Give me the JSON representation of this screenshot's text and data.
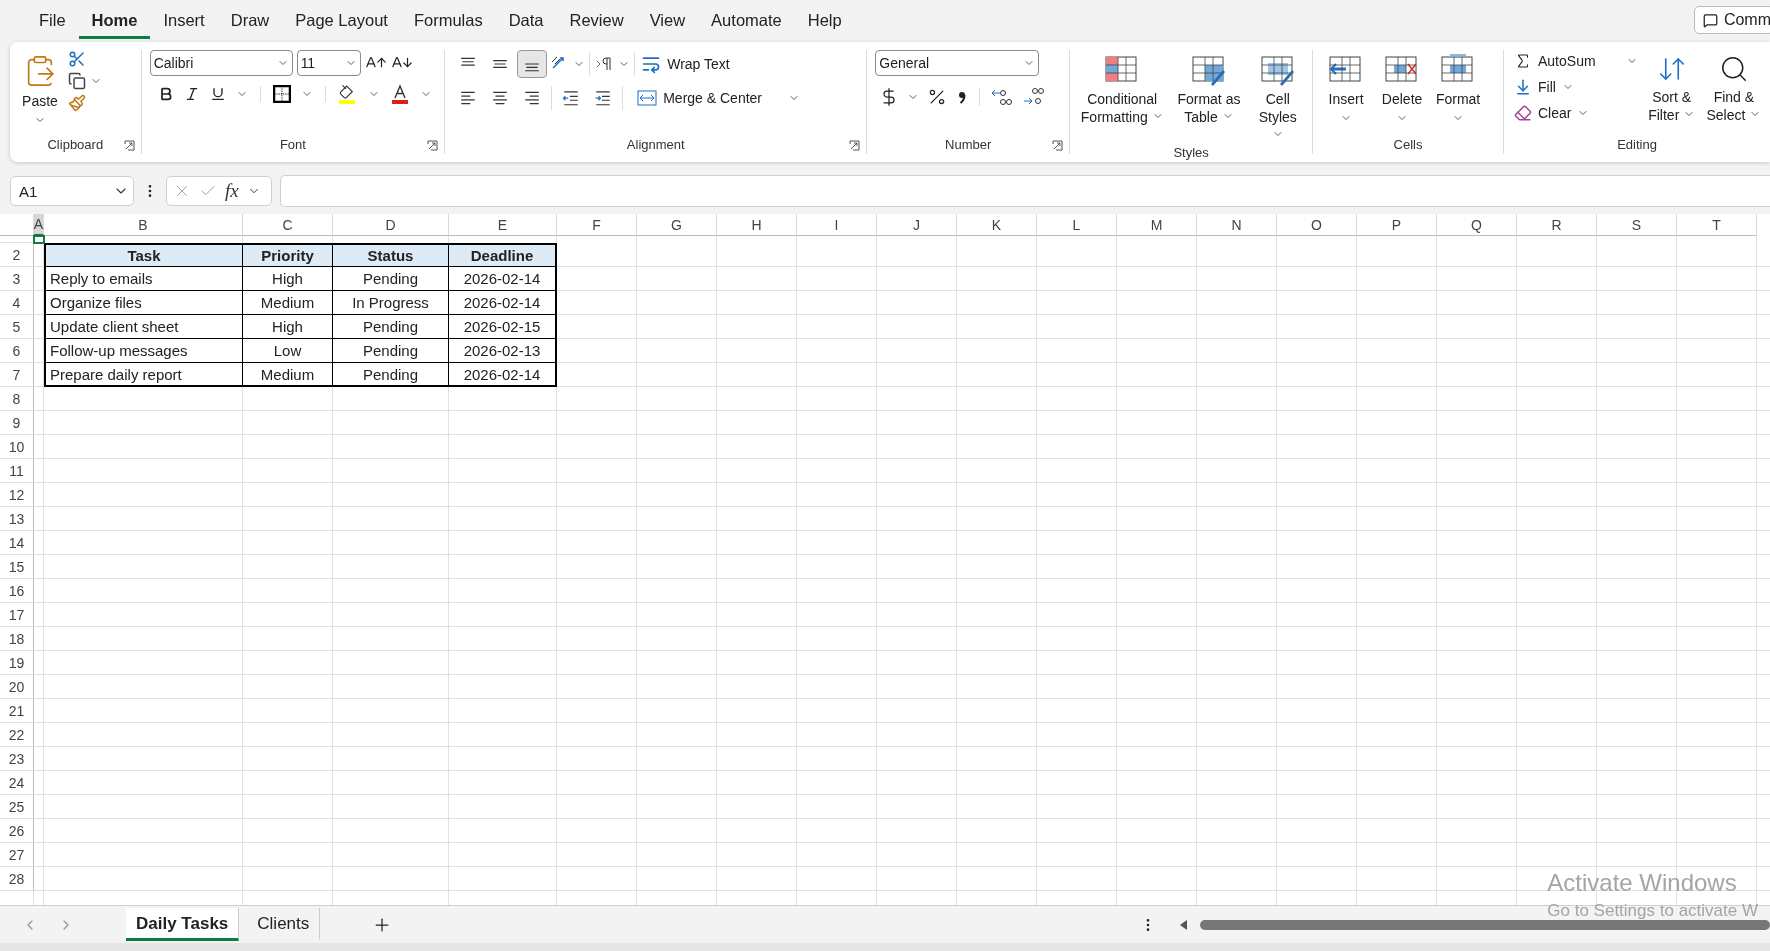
{
  "menu_tabs": [
    {
      "label": "File",
      "selected": false
    },
    {
      "label": "Home",
      "selected": true
    },
    {
      "label": "Insert",
      "selected": false
    },
    {
      "label": "Draw",
      "selected": false
    },
    {
      "label": "Page Layout",
      "selected": false
    },
    {
      "label": "Formulas",
      "selected": false
    },
    {
      "label": "Data",
      "selected": false
    },
    {
      "label": "Review",
      "selected": false
    },
    {
      "label": "View",
      "selected": false
    },
    {
      "label": "Automate",
      "selected": false
    },
    {
      "label": "Help",
      "selected": false
    }
  ],
  "comments_button": "Comm",
  "ribbon": {
    "clipboard": {
      "label": "Clipboard",
      "paste": "Paste"
    },
    "font": {
      "label": "Font",
      "family": "Calibri",
      "size": "11"
    },
    "alignment": {
      "label": "Alignment",
      "bottom_align_selected": true,
      "wrap_text": "Wrap Text",
      "merge_center": "Merge & Center"
    },
    "number": {
      "label": "Number",
      "format": "General"
    },
    "styles": {
      "label": "Styles",
      "buttons": [
        "Conditional Formatting",
        "Format as Table",
        "Cell Styles"
      ]
    },
    "cells": {
      "label": "Cells",
      "buttons": [
        "Insert",
        "Delete",
        "Format"
      ]
    },
    "editing": {
      "label": "Editing",
      "autosum": "AutoSum",
      "fill": "Fill",
      "clear": "Clear",
      "buttons": [
        "Sort & Filter",
        "Find & Select"
      ]
    }
  },
  "formula_bar": {
    "name_box": "A1",
    "fx": "fx"
  },
  "columns": [
    "A",
    "B",
    "C",
    "D",
    "E",
    "F",
    "G",
    "H",
    "I",
    "J",
    "K",
    "L",
    "M",
    "N",
    "O",
    "P",
    "Q",
    "R",
    "S",
    "T"
  ],
  "rows": [
    "2",
    "3",
    "4",
    "5",
    "6",
    "7",
    "8",
    "9",
    "10",
    "11",
    "12",
    "13",
    "14",
    "15",
    "16",
    "17",
    "18",
    "19",
    "20",
    "21",
    "22",
    "23",
    "24",
    "25",
    "26",
    "27",
    "28"
  ],
  "table": {
    "columns": [
      "Task",
      "Priority",
      "Status",
      "Deadline"
    ],
    "rows": [
      [
        "Reply to emails",
        "High",
        "Pending",
        "2026-02-14"
      ],
      [
        "Organize files",
        "Medium",
        "In Progress",
        "2026-02-14"
      ],
      [
        "Update client sheet",
        "High",
        "Pending",
        "2026-02-15"
      ],
      [
        "Follow-up messages",
        "Low",
        "Pending",
        "2026-02-13"
      ],
      [
        "Prepare daily report",
        "Medium",
        "Pending",
        "2026-02-14"
      ]
    ]
  },
  "sheet_tabs": [
    {
      "label": "Daily Tasks",
      "selected": true
    },
    {
      "label": "Clients",
      "selected": false
    }
  ],
  "activation_notice": {
    "title": "Activate Windows",
    "subtitle": "Go to Settings to activate W"
  }
}
